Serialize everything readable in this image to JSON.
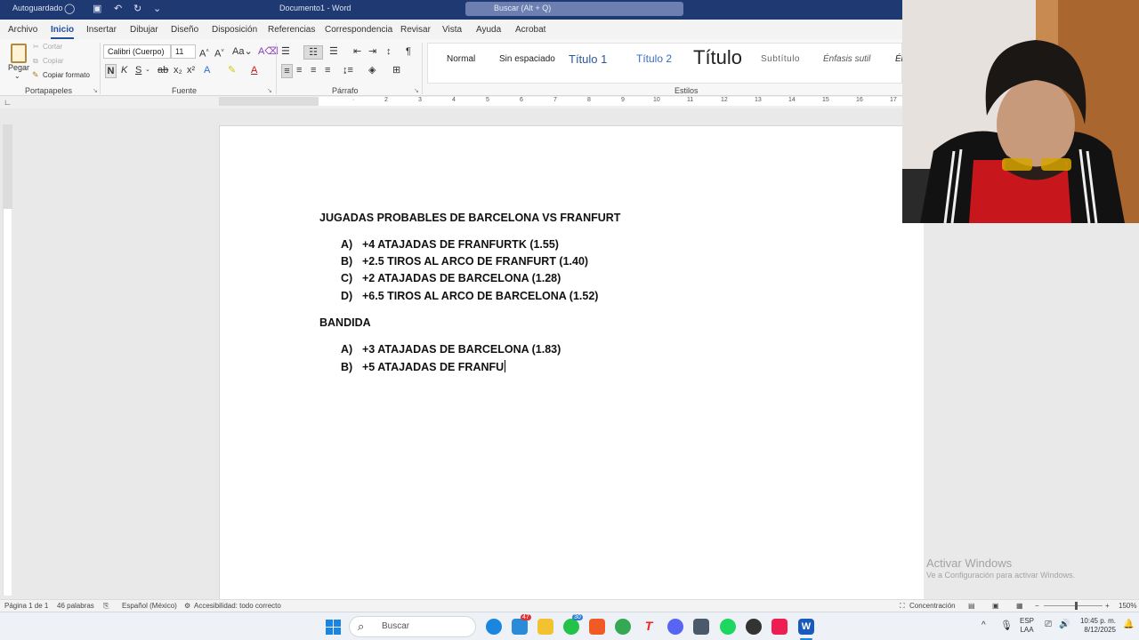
{
  "titlebar": {
    "autosave": "Autoguardado",
    "doc_title": "Documento1 - Word",
    "search_placeholder": "Buscar (Alt + Q)"
  },
  "tabs": [
    "Archivo",
    "Inicio",
    "Insertar",
    "Dibujar",
    "Diseño",
    "Disposición",
    "Referencias",
    "Correspondencia",
    "Revisar",
    "Vista",
    "Ayuda",
    "Acrobat"
  ],
  "active_tab": "Inicio",
  "ribbon": {
    "clipboard": {
      "paste": "Pegar",
      "cut": "Cortar",
      "copy": "Copiar",
      "format_painter": "Copiar formato",
      "label": "Portapapeles"
    },
    "font": {
      "name": "Calibri (Cuerpo)",
      "size": "11",
      "bold": "N",
      "italic": "K",
      "underline": "S",
      "label": "Fuente"
    },
    "paragraph": {
      "label": "Párrafo"
    },
    "styles": {
      "label": "Estilos",
      "items": [
        "Normal",
        "Sin espaciado",
        "Título 1",
        "Título 2",
        "Título",
        "Subtítulo",
        "Énfasis sutil",
        "Én"
      ]
    }
  },
  "document": {
    "title": "JUGADAS PROBABLES DE BARCELONA VS FRANFURT",
    "list1": [
      {
        "marker": "A)",
        "text": "+4 ATAJADAS DE FRANFURTK (1.55)"
      },
      {
        "marker": "B)",
        "text": "+2.5 TIROS AL ARCO DE FRANFURT (1.40)"
      },
      {
        "marker": "C)",
        "text": "+2 ATAJADAS DE BARCELONA (1.28)"
      },
      {
        "marker": "D)",
        "text": "+6.5 TIROS AL ARCO DE BARCELONA (1.52)"
      }
    ],
    "heading2": "BANDIDA",
    "list2": [
      {
        "marker": "A)",
        "text": "+3 ATAJADAS DE BARCELONA (1.83)"
      },
      {
        "marker": "B)",
        "text": "+5 ATAJADAS DE FRANFU"
      }
    ]
  },
  "watermark": {
    "line1": "Activar Windows",
    "line2": "Ve a Configuración para activar Windows."
  },
  "statusbar": {
    "page": "Página 1 de 1",
    "words": "46 palabras",
    "language": "Español (México)",
    "accessibility": "Accesibilidad: todo correcto",
    "focus": "Concentración",
    "zoom": "150%"
  },
  "taskbar": {
    "search": "Buscar",
    "lang1": "ESP",
    "lang2": "LAA",
    "time": "10:45 p. m.",
    "date": "8/12/2025",
    "badge1": "47",
    "badge2": "30"
  },
  "colors": {
    "accent": "#1e4e9c",
    "titlebar": "#1f3a73",
    "word_blue": "#185abd"
  }
}
